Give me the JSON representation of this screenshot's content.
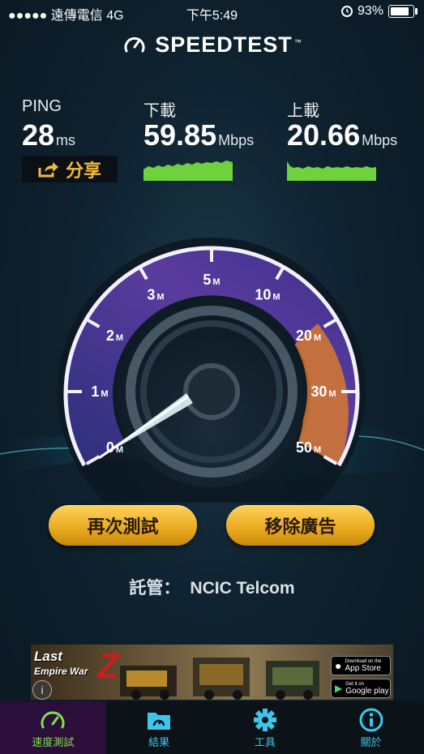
{
  "status_bar": {
    "carrier": "●●●●● 遠傳電信  4G",
    "time": "下午5:49",
    "battery": "93%",
    "battery_level": 0.93
  },
  "app": {
    "title": "SPEEDTEST",
    "trademark": "™"
  },
  "stats": {
    "ping": {
      "label": "PING",
      "value": "28",
      "unit": "ms"
    },
    "download": {
      "label": "下載",
      "value": "59.85",
      "unit": "Mbps"
    },
    "upload": {
      "label": "上載",
      "value": "20.66",
      "unit": "Mbps"
    }
  },
  "share_label": "分享",
  "gauge": {
    "ticks": [
      {
        "value": "0",
        "unit": "M"
      },
      {
        "value": "1",
        "unit": "M"
      },
      {
        "value": "2",
        "unit": "M"
      },
      {
        "value": "3",
        "unit": "M"
      },
      {
        "value": "5",
        "unit": "M"
      },
      {
        "value": "10",
        "unit": "M"
      },
      {
        "value": "20",
        "unit": "M"
      },
      {
        "value": "30",
        "unit": "M"
      },
      {
        "value": "50",
        "unit": "M"
      }
    ]
  },
  "buttons": {
    "retest": "再次測試",
    "remove_ads": "移除廣告"
  },
  "host": {
    "prefix": "託管：",
    "name": "NCIC Telcom"
  },
  "ad": {
    "game_line1": "Last",
    "game_line2": "Empire War",
    "game_z": "Z",
    "app_store_small": "Download on the",
    "app_store": "App Store",
    "google_small": "Get it on",
    "google": "Google play"
  },
  "tabs": [
    {
      "label": "速度測試",
      "icon": "speedometer-icon",
      "active": true
    },
    {
      "label": "結果",
      "icon": "folder-icon"
    },
    {
      "label": "工具",
      "icon": "gear-icon"
    },
    {
      "label": "關於",
      "icon": "info-icon"
    }
  ],
  "colors": {
    "accent_orange": "#f6b83a",
    "accent_cyan": "#3ec6ea",
    "accent_green": "#7fe04a"
  }
}
